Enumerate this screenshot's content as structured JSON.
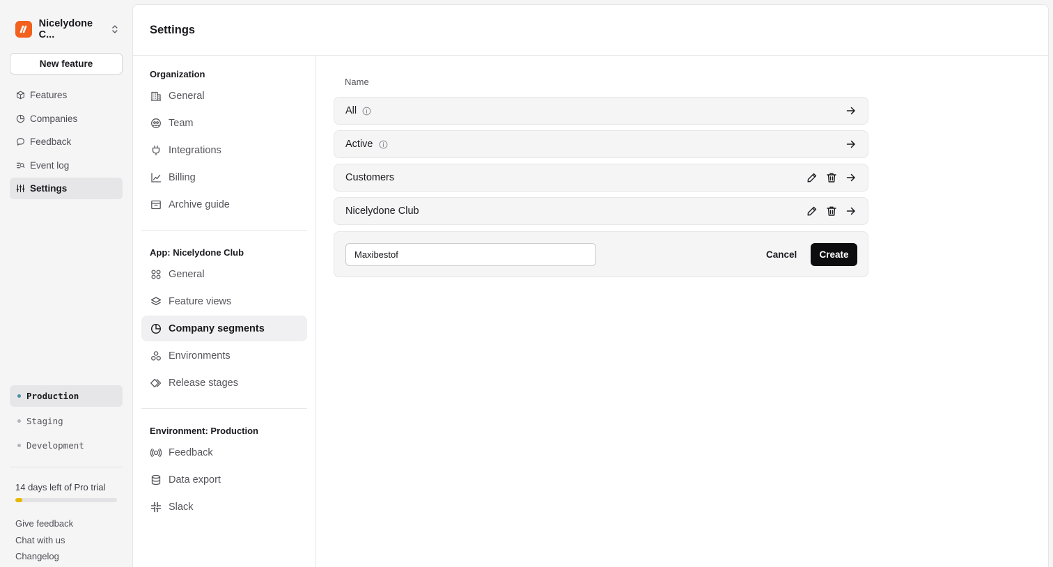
{
  "org": {
    "name": "Nicelydone C...",
    "brand_color": "#f2611d"
  },
  "sidebar": {
    "new_feature_label": "New feature",
    "items": [
      {
        "label": "Features",
        "icon": "cube-icon"
      },
      {
        "label": "Companies",
        "icon": "pie-chart-icon"
      },
      {
        "label": "Feedback",
        "icon": "chat-bubble-icon"
      },
      {
        "label": "Event log",
        "icon": "event-log-icon"
      },
      {
        "label": "Settings",
        "icon": "sliders-icon",
        "active": true
      }
    ],
    "environments": [
      {
        "label": "Production",
        "active": true
      },
      {
        "label": "Staging"
      },
      {
        "label": "Development"
      }
    ],
    "trial": {
      "label": "14 days left of Pro trial",
      "progress": 0.07
    },
    "footer_links": [
      "Give feedback",
      "Chat with us",
      "Changelog"
    ]
  },
  "header": {
    "title": "Settings"
  },
  "settings_nav": {
    "sections": [
      {
        "heading": "Organization",
        "items": [
          {
            "label": "General",
            "icon": "building-icon"
          },
          {
            "label": "Team",
            "icon": "team-icon"
          },
          {
            "label": "Integrations",
            "icon": "plug-icon"
          },
          {
            "label": "Billing",
            "icon": "line-chart-icon"
          },
          {
            "label": "Archive guide",
            "icon": "archive-icon"
          }
        ]
      },
      {
        "heading": "App: Nicelydone Club",
        "items": [
          {
            "label": "General",
            "icon": "grid-circles-icon"
          },
          {
            "label": "Feature views",
            "icon": "layers-icon"
          },
          {
            "label": "Company segments",
            "icon": "pie-chart-icon",
            "active": true
          },
          {
            "label": "Environments",
            "icon": "environments-icon"
          },
          {
            "label": "Release stages",
            "icon": "diamond-icon"
          }
        ]
      },
      {
        "heading": "Environment: Production",
        "items": [
          {
            "label": "Feedback",
            "icon": "feedback-signal-icon"
          },
          {
            "label": "Data export",
            "icon": "database-icon"
          },
          {
            "label": "Slack",
            "icon": "slack-icon"
          }
        ]
      }
    ]
  },
  "segments": {
    "column_label": "Name",
    "rows": [
      {
        "name": "All",
        "info": true,
        "editable": false
      },
      {
        "name": "Active",
        "info": true,
        "editable": false
      },
      {
        "name": "Customers",
        "info": false,
        "editable": true
      },
      {
        "name": "Nicelydone Club",
        "info": false,
        "editable": true
      }
    ],
    "new_segment": {
      "value": "Maxibestof",
      "cancel_label": "Cancel",
      "create_label": "Create"
    }
  }
}
